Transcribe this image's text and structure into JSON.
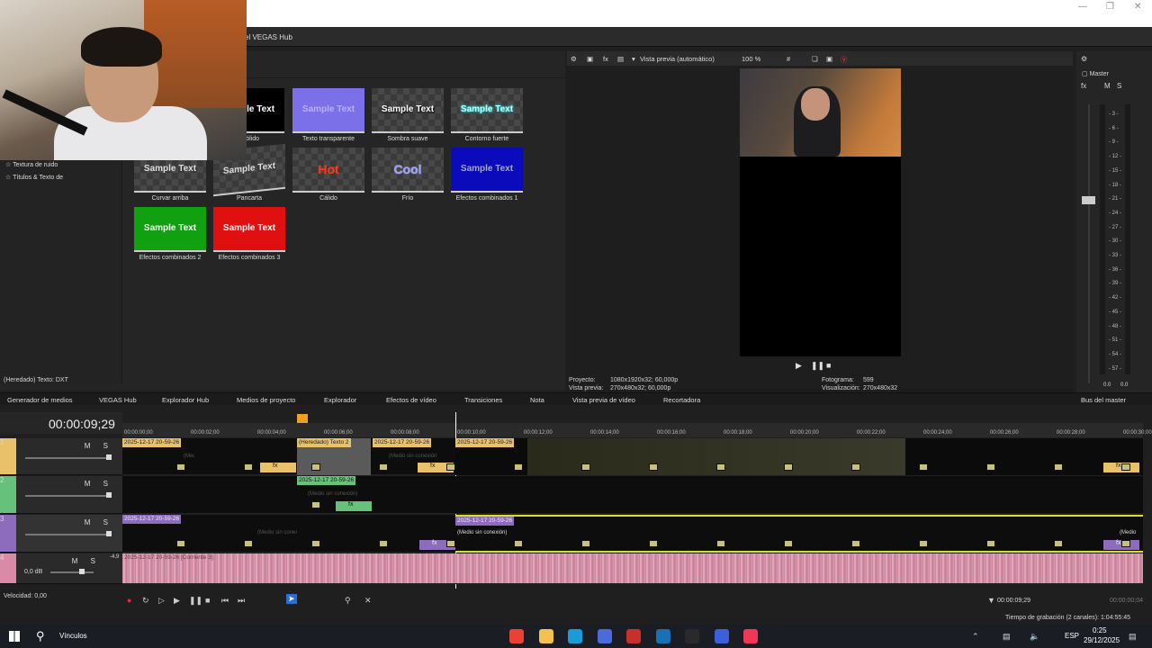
{
  "window": {
    "app_title_fragment": "el VEGAS Hub"
  },
  "left_panel": {
    "tree_items": [
      "Textura de ruido",
      "Títulos & Texto de"
    ],
    "status": "(Heredado) Texto: DXT",
    "presets": [
      {
        "thumb": "Sample Text",
        "label": "o sólido"
      },
      {
        "thumb": "Sample Text",
        "label": "Texto transparente"
      },
      {
        "thumb": "Sample Text",
        "label": "Sombra suave"
      },
      {
        "thumb": "Sample Text",
        "label": "Contorno fuerte"
      },
      {
        "thumb": "Sample Text",
        "label": "Curvar arriba"
      },
      {
        "thumb": "Sample Text",
        "label": "Pancarta"
      },
      {
        "thumb": "Hot",
        "label": "Cálido"
      },
      {
        "thumb": "Cool",
        "label": "Frío"
      },
      {
        "thumb": "Sample Text",
        "label": "Efectos combinados 1"
      },
      {
        "thumb": "Sample Text",
        "label": "Efectos combinados 2"
      },
      {
        "thumb": "Sample Text",
        "label": "Efectos combinados 3"
      }
    ]
  },
  "preview": {
    "mode": "Vista previa (automático)",
    "zoom": "100 %",
    "project_label": "Proyecto:",
    "project_value": "1080x1920x32; 60,000p",
    "preview_label": "Vista previa:",
    "preview_value": "270x480x32; 60,000p",
    "frame_label": "Fotograma:",
    "frame_value": "599",
    "display_label": "Visualización:",
    "display_value": "270x480x32"
  },
  "mixer": {
    "title": "Master",
    "buttons": [
      "fx",
      "M",
      "S"
    ],
    "scale": [
      "3",
      "6",
      "9",
      "12",
      "15",
      "18",
      "21",
      "24",
      "27",
      "30",
      "33",
      "36",
      "39",
      "42",
      "45",
      "48",
      "51",
      "54",
      "57"
    ],
    "left_val": "0.0",
    "right_val": "0.0",
    "tab": "Bus del master"
  },
  "tabs": [
    "Generador de medios",
    "VEGAS Hub",
    "Explorador Hub",
    "Medios de proyecto",
    "Explorador",
    "Efectos de vídeo",
    "Transiciones",
    "Nota",
    "Vista previa de vídeo",
    "Recortadora"
  ],
  "timeline": {
    "timecode": "00:00:09;29",
    "ruler": [
      "00:00:00;00",
      "00:00:02;00",
      "00:00:04;00",
      "00:00:06;00",
      "00:00:08;00",
      "00:00:10;00",
      "00:00:12;00",
      "00:00:14;00",
      "00:00:16;00",
      "00:00:18;00",
      "00:00:20;00",
      "00:00:22;00",
      "00:00:24;00",
      "00:00:26;00",
      "00:00:28;00",
      "00:00:30;00"
    ],
    "tracks": [
      {
        "num": "1",
        "ms": "M S",
        "color": "#e8c16a"
      },
      {
        "num": "2",
        "ms": "M S",
        "color": "#66c27a"
      },
      {
        "num": "3",
        "ms": "M S",
        "color": "#8d6bbd"
      },
      {
        "num": "4",
        "ms": "M S",
        "color": "#d98aa6",
        "vol": "0,0 dB",
        "side": "-4,9"
      }
    ],
    "clip_name": "2025-12-17 20-59-26",
    "clip_text": "(Heredado) Texto 2",
    "offline": "(Medio sin conexión)",
    "offline_short": "(Medio",
    "audio_name": "2025-12-17 20-59-26 [Corriente 3]",
    "fx": "fx"
  },
  "transport": {
    "speed": "Velocidad: 0,00",
    "end_time": "00:00:09;29",
    "length": "00:00:00;04"
  },
  "status": {
    "record": "Tiempo de grabación (2 canales): 1:04:55:45"
  },
  "taskbar": {
    "search": "Vínculos",
    "lang": "ESP",
    "time": "0:25",
    "date": "29/12/2025",
    "icon_colors": [
      "#e94235",
      "#f2c14e",
      "#1b9bd7",
      "#4d6bd8",
      "#c7302b",
      "#1b6fb3",
      "#2a2a2a",
      "#3d5fd9",
      "#f0375a"
    ]
  }
}
